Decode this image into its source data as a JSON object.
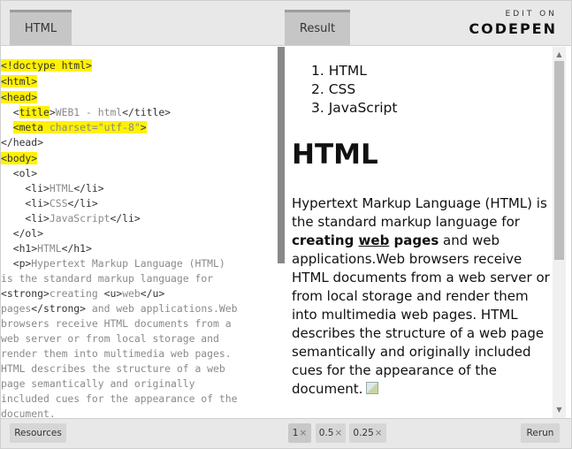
{
  "header": {
    "tab_html": "HTML",
    "tab_result": "Result",
    "edit_on": "EDIT ON",
    "brand": "CODEPEN"
  },
  "code": {
    "lines": [
      "<!doctype html>",
      "<html>",
      "<head>",
      "  <title>WEB1 - html</title>",
      "  <meta charset=\"utf-8\">",
      "</head>",
      "<body>",
      "  <ol>",
      "    <li>HTML</li>",
      "    <li>CSS</li>",
      "    <li>JavaScript</li>",
      "  </ol>",
      "  <h1>HTML</h1>",
      "  <p>Hypertext Markup Language (HTML)",
      "is the standard markup language for",
      "<strong>creating <u>web</u>",
      "pages</strong> and web applications.Web",
      "browsers receive HTML documents from a",
      "web server or from local storage and",
      "render them into multimedia web pages.",
      "HTML describes the structure of a web",
      "page semantically and originally",
      "included cues for the appearance of the",
      "document."
    ],
    "highlight_color": "#fff200"
  },
  "result": {
    "list": [
      "HTML",
      "CSS",
      "JavaScript"
    ],
    "h1": "HTML",
    "p_part1": "Hypertext Markup Language (HTML) is the standard markup language for ",
    "strong_a": "creating ",
    "strong_u": "web",
    "strong_b": " pages",
    "p_part2": " and web applications.Web browsers receive HTML documents from a web server or from local storage and render them into multimedia web pages. HTML describes the structure of a web page semantically and originally included cues for the appearance of the document."
  },
  "footer": {
    "resources": "Resources",
    "zoom_options": [
      "1",
      "0.5",
      "0.25"
    ],
    "zoom_selected": "1",
    "close_symbol": "×",
    "rerun": "Rerun"
  }
}
